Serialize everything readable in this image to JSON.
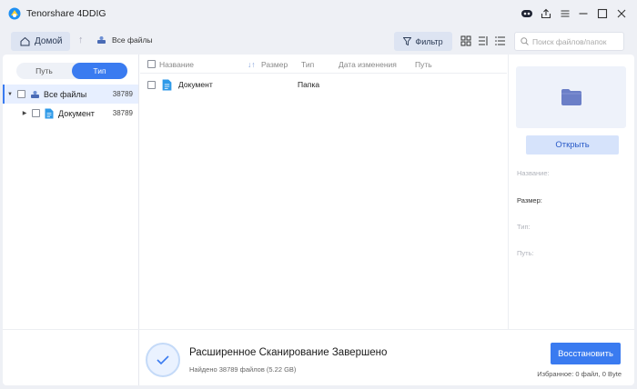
{
  "app": {
    "title": "Tenorshare 4DDIG",
    "brand_color": "#3a7bf0"
  },
  "titlebar": {
    "icons": [
      "assistant-icon",
      "upload-icon",
      "menu-icon",
      "minimize-icon",
      "maximize-icon",
      "close-icon"
    ]
  },
  "toolbar": {
    "home_label": "Домой",
    "breadcrumb": "Все файлы",
    "filter_label": "Фильтр",
    "search_placeholder": "Поиск файлов/папок",
    "view_icons": [
      "grid-view-icon",
      "list-view-icon",
      "detail-view-icon"
    ]
  },
  "sidebar": {
    "tabs": [
      {
        "label": "Путь",
        "active": false
      },
      {
        "label": "Тип",
        "active": true
      }
    ],
    "tree": [
      {
        "label": "Все файлы",
        "count": "38789",
        "selected": true,
        "expanded": true
      },
      {
        "label": "Документ",
        "count": "38789",
        "selected": false,
        "expanded": false
      }
    ]
  },
  "list": {
    "columns": [
      "Название",
      "Размер",
      "Тип",
      "Дата изменения",
      "Путь"
    ],
    "rows": [
      {
        "name": "Документ",
        "size": "",
        "type": "Папка",
        "modified": "",
        "path": ""
      }
    ]
  },
  "detail": {
    "open_label": "Открыть",
    "props": {
      "name_label": "Название:",
      "size_label": "Размер:",
      "type_label": "Тип:",
      "path_label": "Путь:"
    }
  },
  "footer": {
    "status_title": "Расширенное Сканирование Завершено",
    "status_sub": "Найдено 38789 файлов (5.22 GB)",
    "restore_label": "Восстановить",
    "selected_info": "Избранное: 0 файл, 0 Byte"
  }
}
